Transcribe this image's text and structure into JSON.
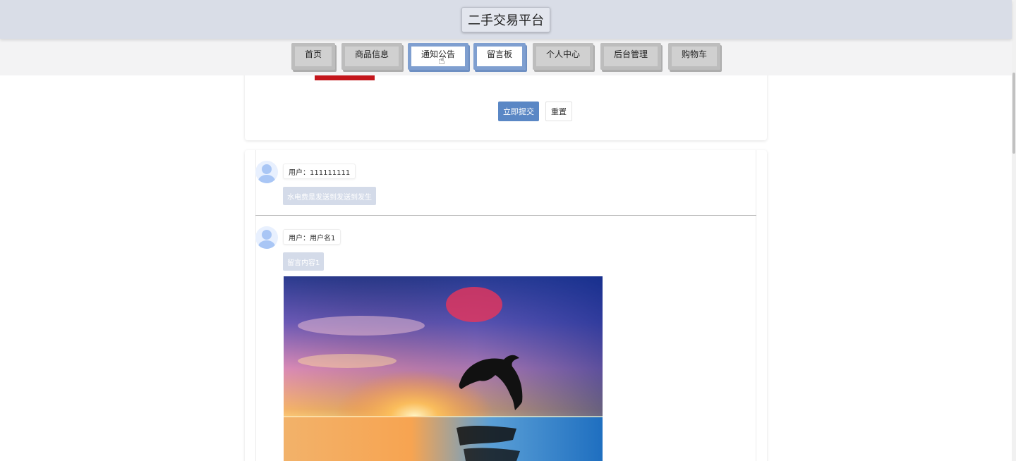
{
  "header": {
    "title": "二手交易平台"
  },
  "nav": {
    "items": [
      {
        "label": "首页",
        "active": false
      },
      {
        "label": "商品信息",
        "active": false
      },
      {
        "label": "通知公告",
        "active": true
      },
      {
        "label": "留言板",
        "active": false
      },
      {
        "label": "个人中心",
        "active": false
      },
      {
        "label": "后台管理",
        "active": false
      },
      {
        "label": "购物车",
        "active": false
      }
    ]
  },
  "form": {
    "submit_label": "立即提交",
    "reset_label": "重置"
  },
  "messages": [
    {
      "user": "用户：111111111",
      "content": "水电费是发送到发送到发生"
    },
    {
      "user": "用户：用户名1",
      "content": "留言内容1",
      "image": "dolphin-sunset"
    }
  ],
  "colors": {
    "accent": "#5a87c5",
    "active_nav_border": "#7f9fd0",
    "red_bar": "#c4161c",
    "header_bg": "#d9dde7"
  }
}
